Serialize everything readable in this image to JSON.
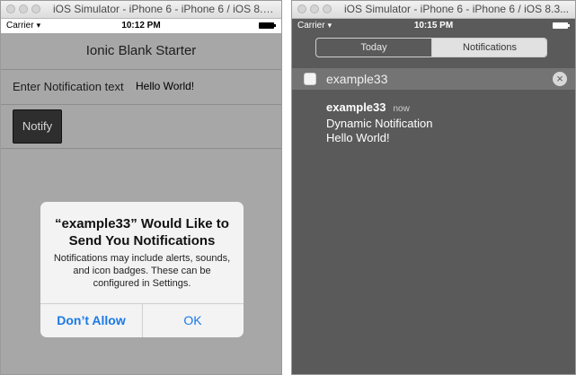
{
  "left_window": {
    "title": "iOS Simulator - iPhone 6 - iPhone 6 / iOS 8.3...",
    "status": {
      "carrier": "Carrier",
      "time": "10:12 PM"
    },
    "app": {
      "header_title": "Ionic Blank Starter",
      "input_label": "Enter Notification text",
      "input_value": "Hello World!",
      "notify_button": "Notify"
    },
    "alert": {
      "title": "“example33” Would Like to Send You Notifications",
      "message": "Notifications may include alerts, sounds, and icon badges. These can be configured in Settings.",
      "deny_label": "Don’t Allow",
      "ok_label": "OK"
    }
  },
  "right_window": {
    "title": "iOS Simulator - iPhone 6 - iPhone 6 / iOS 8.3...",
    "status": {
      "carrier": "Carrier",
      "time": "10:15 PM"
    },
    "tabs": [
      {
        "label": "Today",
        "selected": false
      },
      {
        "label": "Notifications",
        "selected": true
      }
    ],
    "group": {
      "app_name": "example33",
      "clear_icon": "close-circle-icon"
    },
    "notification": {
      "app_name": "example33",
      "time": "now",
      "title": "Dynamic Notification",
      "body": "Hello World!"
    }
  },
  "colors": {
    "alert_button": "#1a7ae8",
    "notify_button_bg": "#2e2e2e",
    "dimmed_background": "#a7a7a7",
    "notification_center_bg": "#5a5a5a"
  }
}
